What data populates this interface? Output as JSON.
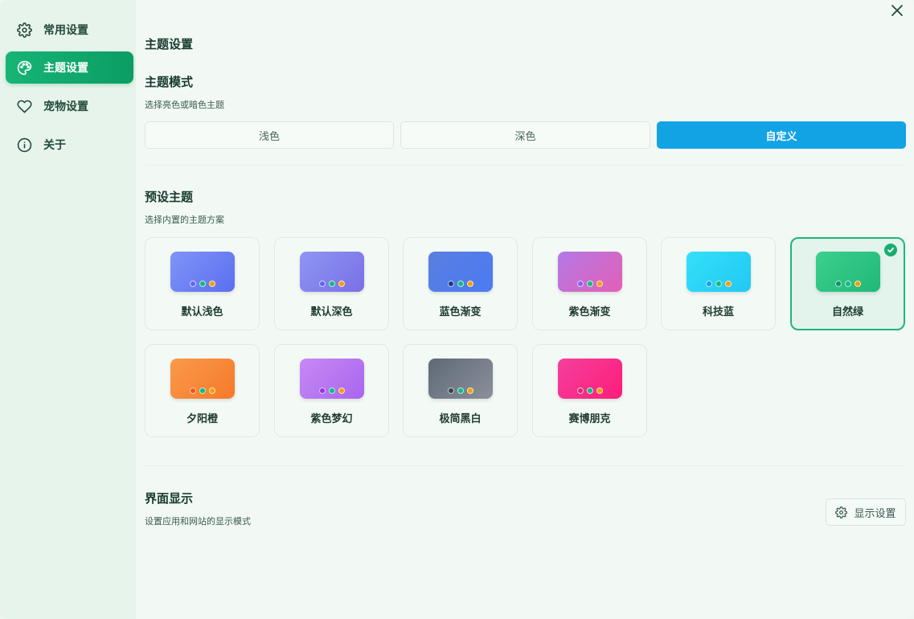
{
  "sidebar": {
    "items": [
      {
        "label": "常用设置",
        "icon": "gear-icon"
      },
      {
        "label": "主题设置",
        "icon": "palette-icon",
        "active": true
      },
      {
        "label": "宠物设置",
        "icon": "heart-icon"
      },
      {
        "label": "关于",
        "icon": "info-icon"
      }
    ]
  },
  "page": {
    "title": "主题设置"
  },
  "theme_mode": {
    "title": "主题模式",
    "subtitle": "选择亮色或暗色主题",
    "options": [
      "浅色",
      "深色",
      "自定义"
    ],
    "selected": "自定义"
  },
  "preset": {
    "title": "预设主题",
    "subtitle": "选择内置的主题方案",
    "themes": [
      {
        "name": "默认浅色",
        "gradient": [
          "#7f95f7",
          "#5c6ef0"
        ],
        "dots": [
          "#6366f1",
          "#10b981",
          "#f59e0b"
        ]
      },
      {
        "name": "默认深色",
        "gradient": [
          "#8e96f2",
          "#7a6fe6"
        ],
        "dots": [
          "#6366f1",
          "#10b981",
          "#f59e0b"
        ]
      },
      {
        "name": "蓝色渐变",
        "gradient": [
          "#5a7ee0",
          "#4a7cf2"
        ],
        "dots": [
          "#1e3a8a",
          "#10b981",
          "#f59e0b"
        ]
      },
      {
        "name": "紫色渐变",
        "gradient": [
          "#b479e8",
          "#e35fb5"
        ],
        "dots": [
          "#8b5cf6",
          "#10b981",
          "#f59e0b"
        ]
      },
      {
        "name": "科技蓝",
        "gradient": [
          "#34e0f7",
          "#22c8f4"
        ],
        "dots": [
          "#0ea5e9",
          "#10b981",
          "#f59e0b"
        ]
      },
      {
        "name": "自然绿",
        "gradient": [
          "#3ccf8e",
          "#21b877"
        ],
        "dots": [
          "#059669",
          "#10b981",
          "#f59e0b"
        ],
        "selected": true
      },
      {
        "name": "夕阳橙",
        "gradient": [
          "#f99a4a",
          "#f57a2a"
        ],
        "dots": [
          "#ea580c",
          "#10b981",
          "#f59e0b"
        ]
      },
      {
        "name": "紫色梦幻",
        "gradient": [
          "#c78af5",
          "#a865ee"
        ],
        "dots": [
          "#9333ea",
          "#10b981",
          "#f59e0b"
        ]
      },
      {
        "name": "极简黑白",
        "gradient": [
          "#5f6876",
          "#8a919c"
        ],
        "dots": [
          "#374151",
          "#10b981",
          "#f59e0b"
        ]
      },
      {
        "name": "赛博朋克",
        "gradient": [
          "#f43f9c",
          "#ff1d7a"
        ],
        "dots": [
          "#db2777",
          "#10b981",
          "#f59e0b"
        ]
      }
    ]
  },
  "interface": {
    "title": "界面显示",
    "subtitle": "设置应用和网站的显示模式",
    "button_label": "显示设置"
  },
  "colors": {
    "accent_green": "#17b476",
    "accent_blue": "#12a3e4"
  }
}
